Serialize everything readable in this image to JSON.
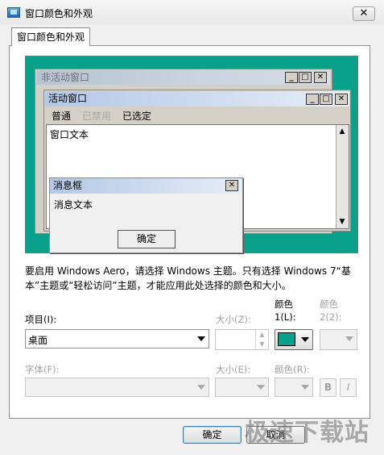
{
  "window": {
    "title": "窗口颜色和外观",
    "close_glyph": "✕"
  },
  "tab": {
    "label": "窗口颜色和外观"
  },
  "preview": {
    "inactive_title": "非活动窗口",
    "active_title": "活动窗口",
    "menu": {
      "normal": "普通",
      "disabled": "已禁用",
      "selected": "已选定"
    },
    "window_text": "窗口文本",
    "message_box": {
      "title": "消息框",
      "text": "消息文本",
      "ok": "确定"
    },
    "caption_buttons": {
      "min": "_",
      "max": "□",
      "close": "✕"
    },
    "scroll_up": "▲",
    "scroll_down": "▼",
    "desktop_color": "#0aa18c"
  },
  "info_text": "要启用 Windows Aero，请选择 Windows 主题。只有选择 Windows 7“基本”主题或“轻松访问”主题，才能应用此处选择的颜色和大小。",
  "form": {
    "item_label": "项目(I):",
    "item_value": "桌面",
    "size_label": "大小(Z):",
    "size_value": "",
    "color1_label": "颜色 1(L):",
    "color1_value": "#0aa18c",
    "color2_label": "颜色 2(2):",
    "font_label": "字体(F):",
    "font_size_label": "大小(E):",
    "font_color_label": "颜色(R):",
    "bold": "B",
    "italic": "I",
    "spin_up": "▲",
    "spin_down": "▼"
  },
  "buttons": {
    "ok": "确定",
    "cancel": "取消"
  },
  "watermark": "极速下载站"
}
